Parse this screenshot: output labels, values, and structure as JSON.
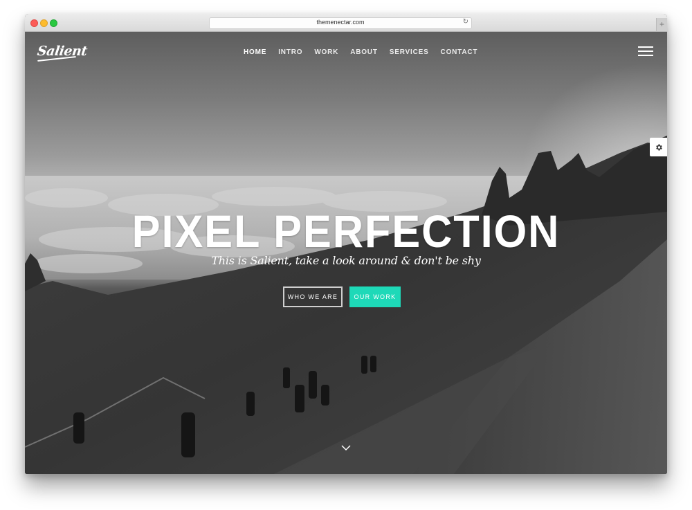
{
  "browser": {
    "url": "themenectar.com",
    "reload_icon": "reload-icon",
    "new_tab_icon": "plus-icon"
  },
  "site": {
    "logo": "Salient",
    "nav": [
      {
        "label": "HOME",
        "active": true
      },
      {
        "label": "INTRO",
        "active": false
      },
      {
        "label": "WORK",
        "active": false
      },
      {
        "label": "ABOUT",
        "active": false
      },
      {
        "label": "SERVICES",
        "active": false
      },
      {
        "label": "CONTACT",
        "active": false
      }
    ],
    "menu_icon": "hamburger-icon",
    "settings_icon": "gear-icon"
  },
  "hero": {
    "headline": "PIXEL PERFECTION",
    "subheadline": "This is Salient, take a look around & don't be shy",
    "buttons": {
      "primary": "WHO WE ARE",
      "secondary": "OUR WORK"
    },
    "scroll_icon": "chevron-down-icon"
  },
  "colors": {
    "accent": "#1ed9b8",
    "text": "#ffffff"
  }
}
